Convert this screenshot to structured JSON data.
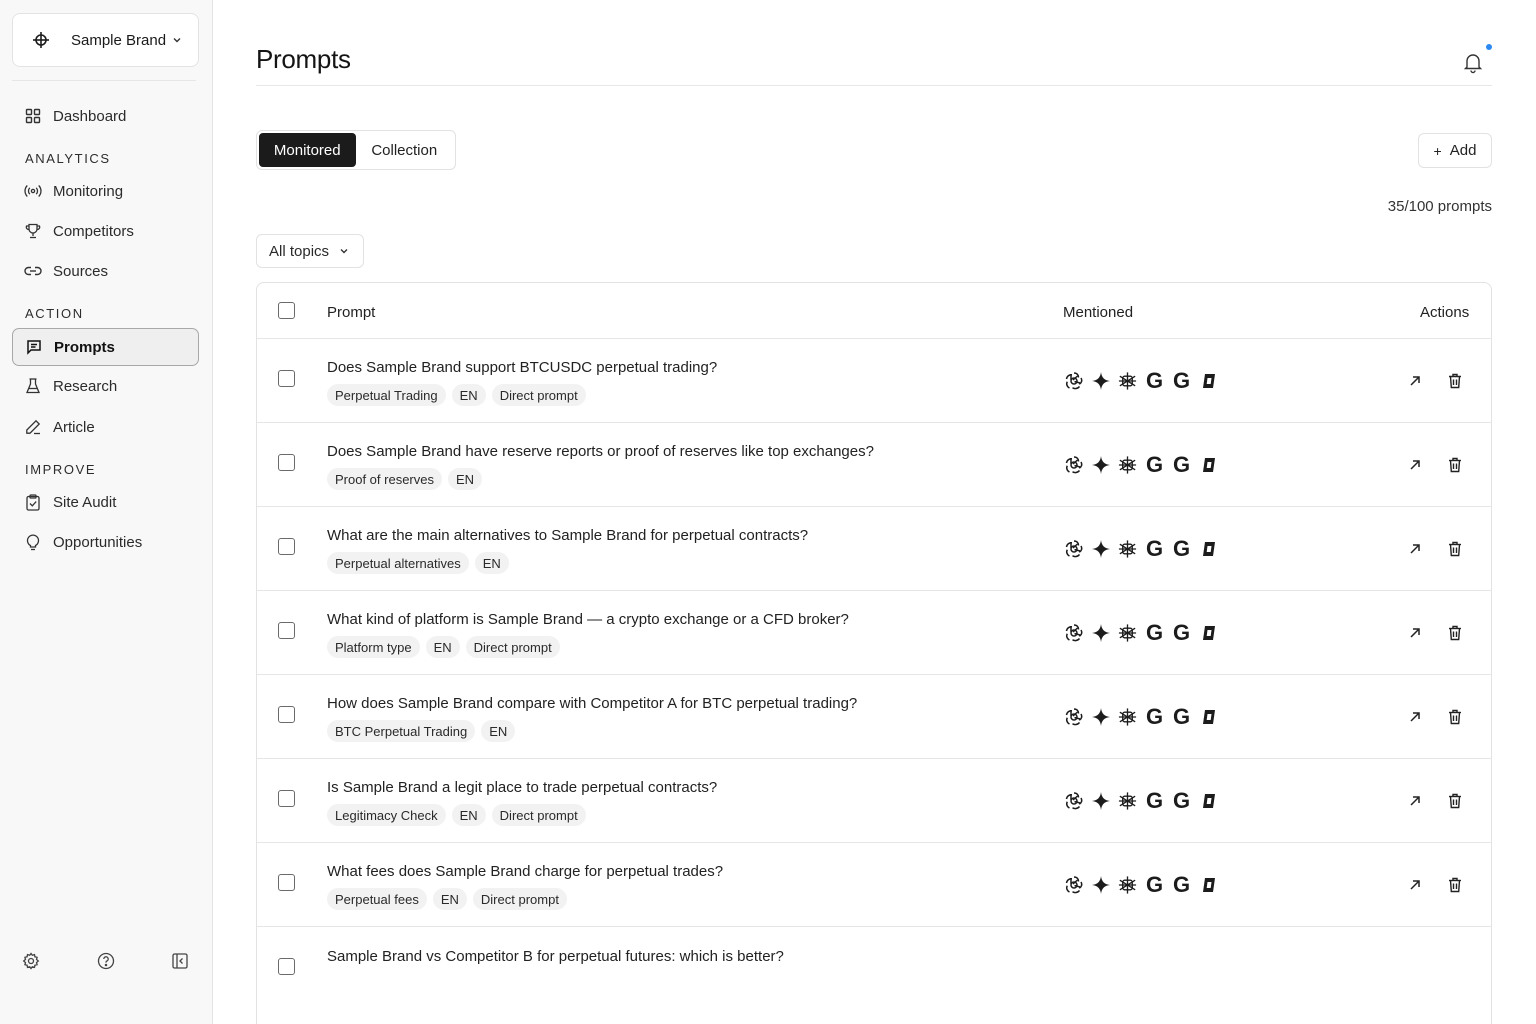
{
  "brand": {
    "name": "Sample Brand"
  },
  "sidebar": {
    "dashboard": "Dashboard",
    "sections": {
      "analytics": "ANALYTICS",
      "action": "ACTION",
      "improve": "IMPROVE"
    },
    "items": {
      "monitoring": "Monitoring",
      "competitors": "Competitors",
      "sources": "Sources",
      "prompts": "Prompts",
      "research": "Research",
      "article": "Article",
      "site_audit": "Site Audit",
      "opportunities": "Opportunities"
    },
    "active": "Prompts"
  },
  "page": {
    "title": "Prompts"
  },
  "tabs": {
    "monitored": "Monitored",
    "collection": "Collection",
    "active": "Monitored"
  },
  "toolbar": {
    "add_label": "Add",
    "count": "35/100 prompts",
    "filter": "All topics"
  },
  "table": {
    "headers": {
      "prompt": "Prompt",
      "mentioned": "Mentioned",
      "actions": "Actions"
    },
    "mention_icons": [
      "openai-icon",
      "sparkle-icon",
      "claude-icon",
      "google-g-icon",
      "google-g-icon",
      "copilot-icon"
    ],
    "rows": [
      {
        "prompt": "Does Sample Brand support BTCUSDC perpetual trading?",
        "tags": [
          "Perpetual Trading",
          "EN",
          "Direct prompt"
        ]
      },
      {
        "prompt": "Does Sample Brand have reserve reports or proof of reserves like top exchanges?",
        "tags": [
          "Proof of reserves",
          "EN"
        ]
      },
      {
        "prompt": "What are the main alternatives to Sample Brand for perpetual contracts?",
        "tags": [
          "Perpetual alternatives",
          "EN"
        ]
      },
      {
        "prompt": "What kind of platform is Sample Brand — a crypto exchange or a CFD broker?",
        "tags": [
          "Platform type",
          "EN",
          "Direct prompt"
        ]
      },
      {
        "prompt": "How does Sample Brand compare with Competitor A for BTC perpetual trading?",
        "tags": [
          "BTC Perpetual Trading",
          "EN"
        ]
      },
      {
        "prompt": "Is Sample Brand a legit place to trade perpetual contracts?",
        "tags": [
          "Legitimacy Check",
          "EN",
          "Direct prompt"
        ]
      },
      {
        "prompt": "What fees does Sample Brand charge for perpetual trades?",
        "tags": [
          "Perpetual fees",
          "EN",
          "Direct prompt"
        ]
      },
      {
        "prompt": "Sample Brand vs Competitor B for perpetual futures: which is better?",
        "tags": []
      }
    ]
  }
}
